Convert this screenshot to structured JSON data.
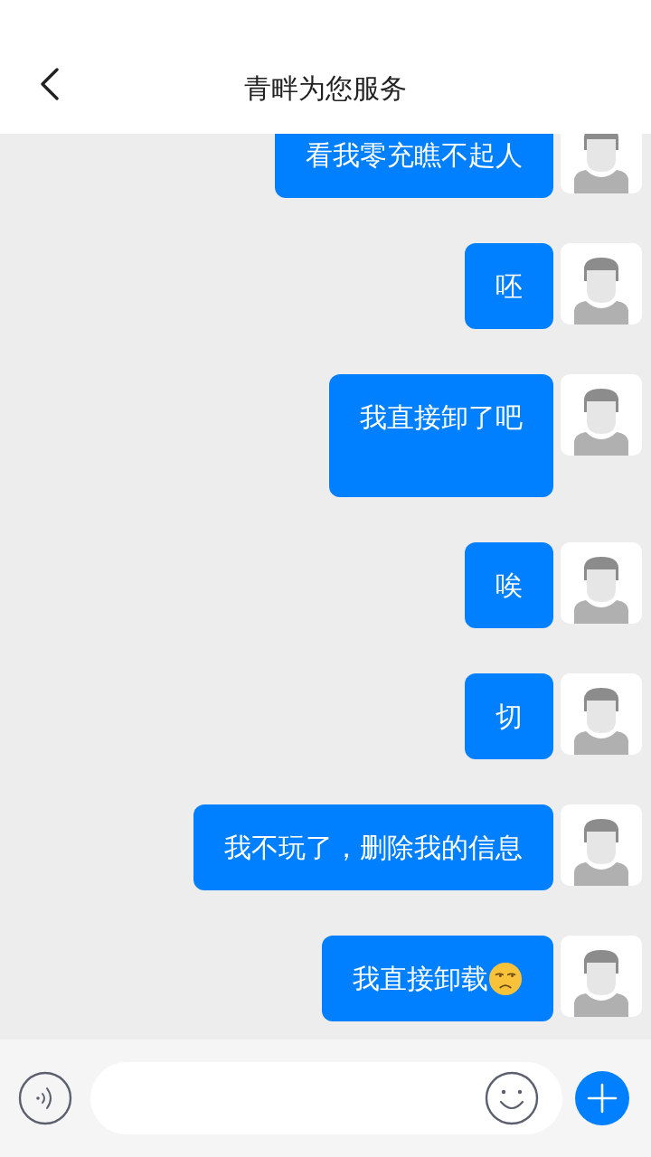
{
  "header": {
    "title": "青畔为您服务"
  },
  "messages": [
    {
      "text": "看我零充瞧不起人"
    },
    {
      "text": "呸"
    },
    {
      "text": "我直接卸了吧\n"
    },
    {
      "text": "唉"
    },
    {
      "text": "切"
    },
    {
      "text": "我不玩了，删除我的信息"
    },
    {
      "text": "我直接卸载",
      "trailing_emoji": true
    }
  ]
}
